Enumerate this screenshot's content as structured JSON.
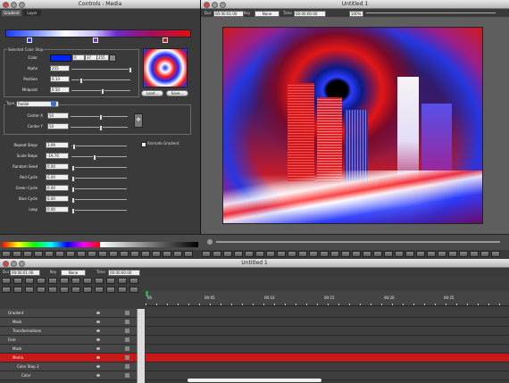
{
  "controls_window": {
    "title": "Controls : Media",
    "tabs": [
      "Gradient",
      "Layer"
    ],
    "selected_color_stop": "Selected Color Stop",
    "color_label": "Color",
    "color_values": [
      "0",
      "37",
      "255"
    ],
    "alpha_label": "Alpha",
    "alpha_value": "255",
    "position_label": "Position",
    "position_value": "0.13",
    "midpoint_label": "Midpoint",
    "midpoint_value": "0.50",
    "load_button": "Load...",
    "save_button": "Save...",
    "type_label": "Type",
    "type_value": "Radial",
    "center_x_label": "Center X",
    "center_x_value": "50",
    "center_y_label": "Center Y",
    "center_y_value": "50",
    "repeat_steps_label": "Repeat Steps",
    "repeat_steps_value": "3.09",
    "scale_steps_label": "Scale Steps",
    "scale_steps_value": "-19.70",
    "random_seed_label": "Random Seed",
    "random_seed_value": "0.00",
    "red_cycle_label": "Red Cycle",
    "red_cycle_value": "0.00",
    "green_cycle_label": "Green Cycle",
    "green_cycle_value": "0.00",
    "blue_cycle_label": "Blue Cycle",
    "blue_cycle_value": "0.00",
    "loop_label": "Loop",
    "loop_value": "0.00",
    "animate_gradient_label": "Animate Gradient"
  },
  "viewer_window": {
    "title": "Untitled 1",
    "dur_label": "Dur",
    "dur_value": "00:00:01:00",
    "key_label": "Key",
    "key_value": "None",
    "time_label": "Time",
    "time_value": "00:00:00:00",
    "zoom_value": "100%"
  },
  "timeline_window": {
    "title": "Untitled 1",
    "dur_label": "Dur",
    "dur_value": "00:00:01:00",
    "key_label": "Key",
    "key_value": "None",
    "time_label": "Time",
    "time_value": "00:00:00:00",
    "ruler_ticks": [
      "00",
      "00:05",
      "00:10",
      "00:15",
      "00:20",
      "00:25"
    ],
    "tracks": [
      {
        "label": "Gradient",
        "indent": 1
      },
      {
        "label": "Mask",
        "indent": 2
      },
      {
        "label": "Transformations",
        "indent": 2
      },
      {
        "label": "Fore",
        "indent": 1
      },
      {
        "label": "Mask",
        "indent": 2
      },
      {
        "label": "Media",
        "indent": 2
      },
      {
        "label": "Color Stop 2",
        "indent": 3
      },
      {
        "label": "Color",
        "indent": 4
      }
    ]
  },
  "colors": {
    "accent_red": "#cc1010",
    "panel_bg": "#3c3c3c",
    "selected_track": "#c81818"
  },
  "icons": [
    "close-icon",
    "minimize-icon",
    "zoom-icon",
    "play-icon",
    "rewind-icon",
    "fast-forward-icon",
    "loop-icon",
    "gear-icon",
    "eye-icon",
    "lock-icon"
  ]
}
